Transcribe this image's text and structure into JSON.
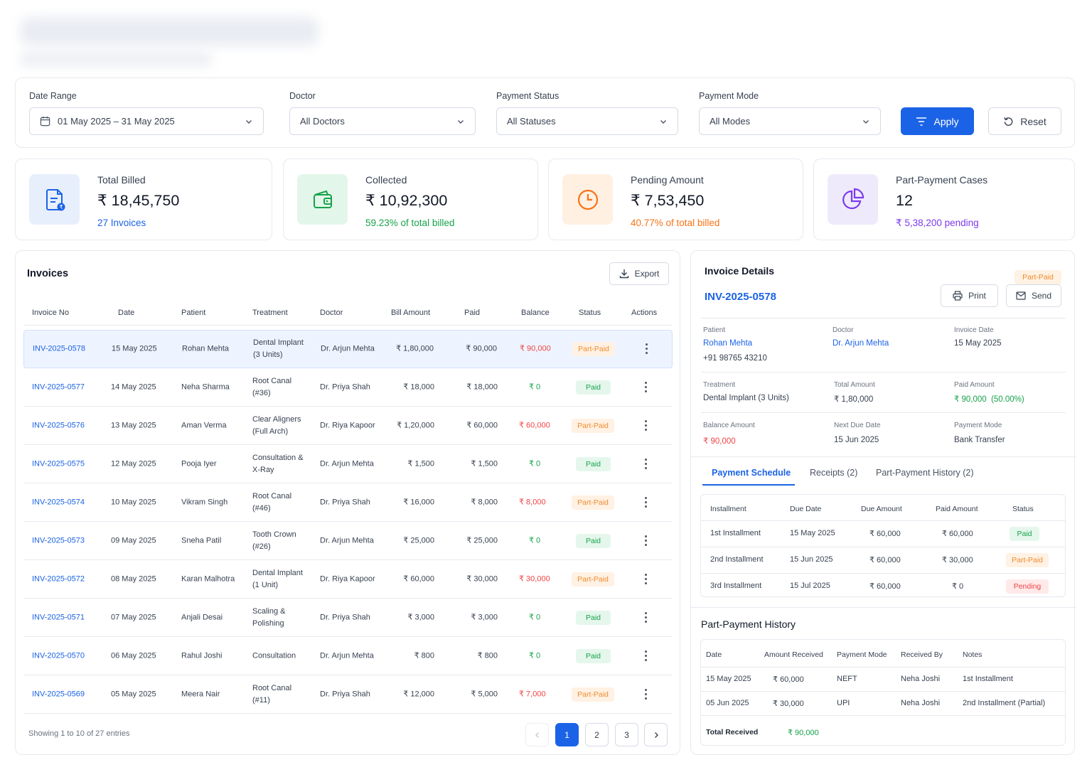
{
  "filters": {
    "date_range": {
      "label": "Date Range",
      "value": "01 May 2025 – 31 May 2025"
    },
    "doctor": {
      "label": "Doctor",
      "value": "All Doctors"
    },
    "payment_status": {
      "label": "Payment Status",
      "value": "All Statuses"
    },
    "payment_mode": {
      "label": "Payment Mode",
      "value": "All Modes"
    },
    "apply_label": "Apply",
    "reset_label": "Reset"
  },
  "kpis": {
    "total_billed": {
      "label": "Total Billed",
      "value": "₹ 18,45,750",
      "sub": "27 Invoices"
    },
    "collected": {
      "label": "Collected",
      "value": "₹ 10,92,300",
      "sub": "59.23% of total billed"
    },
    "pending": {
      "label": "Pending Amount",
      "value": "₹ 7,53,450",
      "sub": "40.77% of total billed"
    },
    "part_payment": {
      "label": "Part-Payment Cases",
      "value": "12",
      "sub": "₹ 5,38,200 pending"
    }
  },
  "colors": {
    "accent": "#1b63e6",
    "paid": "#16a34a",
    "part_paid": "#f08c2e",
    "pending": "#ef4444",
    "purple": "#7c3aed"
  },
  "invoices": {
    "title": "Invoices",
    "export_label": "Export",
    "columns": [
      "Invoice No",
      "Date",
      "Patient",
      "Treatment",
      "Doctor",
      "Bill Amount",
      "Paid",
      "Balance",
      "Status",
      "Actions"
    ],
    "rows": [
      {
        "no": "INV-2025-0578",
        "date": "15 May 2025",
        "patient": "Rohan Mehta",
        "t1": "Dental Implant",
        "t2": "(3 Units)",
        "doctor": "Dr. Arjun Mehta",
        "bill": "₹ 1,80,000",
        "paid": "₹ 90,000",
        "balance": "₹ 90,000",
        "status": "Part-Paid"
      },
      {
        "no": "INV-2025-0577",
        "date": "14 May 2025",
        "patient": "Neha Sharma",
        "t1": "Root Canal",
        "t2": "(#36)",
        "doctor": "Dr. Priya Shah",
        "bill": "₹ 18,000",
        "paid": "₹ 18,000",
        "balance": "₹ 0",
        "status": "Paid"
      },
      {
        "no": "INV-2025-0576",
        "date": "13 May 2025",
        "patient": "Aman Verma",
        "t1": "Clear Aligners",
        "t2": "(Full Arch)",
        "doctor": "Dr. Riya Kapoor",
        "bill": "₹ 1,20,000",
        "paid": "₹ 60,000",
        "balance": "₹ 60,000",
        "status": "Part-Paid"
      },
      {
        "no": "INV-2025-0575",
        "date": "12 May 2025",
        "patient": "Pooja Iyer",
        "t1": "Consultation &",
        "t2": "X-Ray",
        "doctor": "Dr. Arjun Mehta",
        "bill": "₹ 1,500",
        "paid": "₹ 1,500",
        "balance": "₹ 0",
        "status": "Paid"
      },
      {
        "no": "INV-2025-0574",
        "date": "10 May 2025",
        "patient": "Vikram Singh",
        "t1": "Root Canal",
        "t2": "(#46)",
        "doctor": "Dr. Priya Shah",
        "bill": "₹ 16,000",
        "paid": "₹ 8,000",
        "balance": "₹ 8,000",
        "status": "Part-Paid"
      },
      {
        "no": "INV-2025-0573",
        "date": "09 May 2025",
        "patient": "Sneha Patil",
        "t1": "Tooth Crown",
        "t2": "(#26)",
        "doctor": "Dr. Arjun Mehta",
        "bill": "₹ 25,000",
        "paid": "₹ 25,000",
        "balance": "₹ 0",
        "status": "Paid"
      },
      {
        "no": "INV-2025-0572",
        "date": "08 May 2025",
        "patient": "Karan Malhotra",
        "t1": "Dental Implant",
        "t2": "(1 Unit)",
        "doctor": "Dr. Riya Kapoor",
        "bill": "₹ 60,000",
        "paid": "₹ 30,000",
        "balance": "₹ 30,000",
        "status": "Part-Paid"
      },
      {
        "no": "INV-2025-0571",
        "date": "07 May 2025",
        "patient": "Anjali Desai",
        "t1": "Scaling &",
        "t2": "Polishing",
        "doctor": "Dr. Priya Shah",
        "bill": "₹ 3,000",
        "paid": "₹ 3,000",
        "balance": "₹ 0",
        "status": "Paid"
      },
      {
        "no": "INV-2025-0570",
        "date": "06 May 2025",
        "patient": "Rahul Joshi",
        "t1": "Consultation",
        "t2": "",
        "doctor": "Dr. Arjun Mehta",
        "bill": "₹ 800",
        "paid": "₹ 800",
        "balance": "₹ 0",
        "status": "Paid"
      },
      {
        "no": "INV-2025-0569",
        "date": "05 May 2025",
        "patient": "Meera Nair",
        "t1": "Root Canal",
        "t2": "(#11)",
        "doctor": "Dr. Priya Shah",
        "bill": "₹ 12,000",
        "paid": "₹ 5,000",
        "balance": "₹ 7,000",
        "status": "Part-Paid"
      }
    ],
    "showing": "Showing 1 to 10 of 27 entries",
    "pages": [
      "1",
      "2",
      "3"
    ],
    "active_page": "1"
  },
  "details": {
    "title": "Invoice Details",
    "status_badge": "Part-Paid",
    "invoice_no": "INV-2025-0578",
    "print_label": "Print",
    "send_label": "Send",
    "patient_label": "Patient",
    "patient_name": "Rohan Mehta",
    "patient_phone": "+91 98765 43210",
    "doctor_label": "Doctor",
    "doctor_name": "Dr. Arjun Mehta",
    "invoice_date_label": "Invoice Date",
    "invoice_date": "15 May 2025",
    "treatment_label": "Treatment",
    "treatment": "Dental Implant (3 Units)",
    "total_label": "Total Amount",
    "total": "₹ 1,80,000",
    "paid_label": "Paid Amount",
    "paid": "₹ 90,000  (50.00%)",
    "balance_label": "Balance Amount",
    "balance": "₹ 90,000",
    "next_due_label": "Next Due Date",
    "next_due": "15 Jun 2025",
    "mode_label": "Payment Mode",
    "mode": "Bank Transfer",
    "tabs": [
      "Payment Schedule",
      "Receipts (2)",
      "Part-Payment History (2)"
    ],
    "schedule": {
      "columns": [
        "Installment",
        "Due Date",
        "Due Amount",
        "Paid Amount",
        "Status"
      ],
      "rows": [
        {
          "inst": "1st Installment",
          "due": "15 May 2025",
          "amt": "₹ 60,000",
          "paid": "₹ 60,000",
          "status": "Paid"
        },
        {
          "inst": "2nd Installment",
          "due": "15 Jun 2025",
          "amt": "₹ 60,000",
          "paid": "₹ 30,000",
          "status": "Part-Paid"
        },
        {
          "inst": "3rd Installment",
          "due": "15 Jul 2025",
          "amt": "₹ 60,000",
          "paid": "₹ 0",
          "status": "Pending"
        }
      ]
    },
    "history": {
      "title": "Part-Payment History",
      "columns": [
        "Date",
        "Amount Received",
        "Payment Mode",
        "Received By",
        "Notes"
      ],
      "rows": [
        {
          "date": "15 May 2025",
          "amount": "₹ 60,000",
          "mode": "NEFT",
          "by": "Neha Joshi",
          "notes": "1st Installment"
        },
        {
          "date": "05 Jun 2025",
          "amount": "₹ 30,000",
          "mode": "UPI",
          "by": "Neha Joshi",
          "notes": "2nd Installment (Partial)"
        }
      ],
      "total_label": "Total Received",
      "total_value": "₹ 90,000"
    }
  }
}
